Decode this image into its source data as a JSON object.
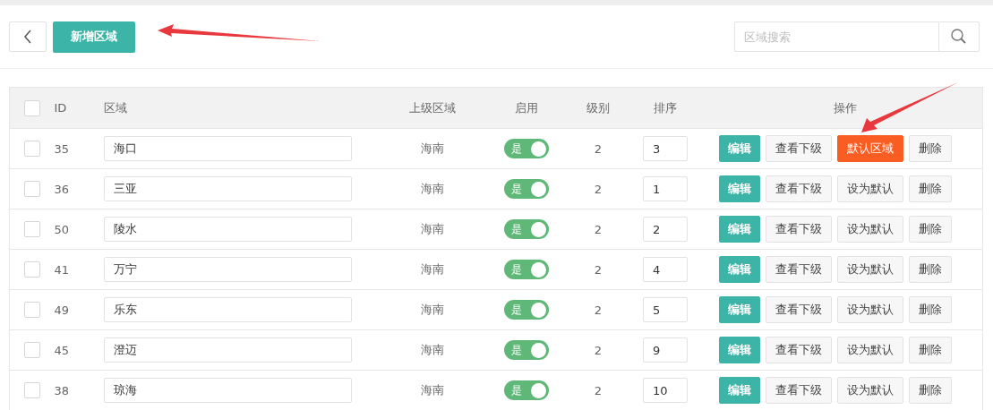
{
  "toolbar": {
    "add_button": "新增区域",
    "search": {
      "placeholder": "区域搜索"
    }
  },
  "table": {
    "select_all_checked": false,
    "columns": [
      "ID",
      "区域",
      "上级区域",
      "启用",
      "级别",
      "排序",
      "操作"
    ],
    "rows": [
      {
        "selected": false,
        "id": "35",
        "name": "海口",
        "parent": "海南",
        "enabled": true,
        "enabled_label": "是",
        "level": "2",
        "sort": "3",
        "actions": {
          "edit": "编辑",
          "children": "查看下级",
          "is_default": true,
          "default": "默认区域",
          "delete": "删除"
        }
      },
      {
        "selected": false,
        "id": "36",
        "name": "三亚",
        "parent": "海南",
        "enabled": true,
        "enabled_label": "是",
        "level": "2",
        "sort": "1",
        "actions": {
          "edit": "编辑",
          "children": "查看下级",
          "is_default": false,
          "default": "设为默认",
          "delete": "删除"
        }
      },
      {
        "selected": false,
        "id": "50",
        "name": "陵水",
        "parent": "海南",
        "enabled": true,
        "enabled_label": "是",
        "level": "2",
        "sort": "2",
        "actions": {
          "edit": "编辑",
          "children": "查看下级",
          "is_default": false,
          "default": "设为默认",
          "delete": "删除"
        }
      },
      {
        "selected": false,
        "id": "41",
        "name": "万宁",
        "parent": "海南",
        "enabled": true,
        "enabled_label": "是",
        "level": "2",
        "sort": "4",
        "actions": {
          "edit": "编辑",
          "children": "查看下级",
          "is_default": false,
          "default": "设为默认",
          "delete": "删除"
        }
      },
      {
        "selected": false,
        "id": "49",
        "name": "乐东",
        "parent": "海南",
        "enabled": true,
        "enabled_label": "是",
        "level": "2",
        "sort": "5",
        "actions": {
          "edit": "编辑",
          "children": "查看下级",
          "is_default": false,
          "default": "设为默认",
          "delete": "删除"
        }
      },
      {
        "selected": false,
        "id": "45",
        "name": "澄迈",
        "parent": "海南",
        "enabled": true,
        "enabled_label": "是",
        "level": "2",
        "sort": "9",
        "actions": {
          "edit": "编辑",
          "children": "查看下级",
          "is_default": false,
          "default": "设为默认",
          "delete": "删除"
        }
      },
      {
        "selected": false,
        "id": "38",
        "name": "琼海",
        "parent": "海南",
        "enabled": true,
        "enabled_label": "是",
        "level": "2",
        "sort": "10",
        "actions": {
          "edit": "编辑",
          "children": "查看下级",
          "is_default": false,
          "default": "设为默认",
          "delete": "删除"
        }
      }
    ]
  }
}
